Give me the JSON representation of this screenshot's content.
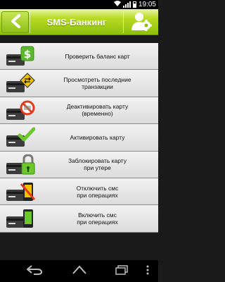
{
  "status_bar": {
    "time": "19:05"
  },
  "header": {
    "title": "SMS-Банкинг"
  },
  "menu": {
    "items": [
      {
        "label": "Проверить баланс карт",
        "icon": "card-dollar-icon"
      },
      {
        "label": "Просмотреть последние\nтранзакции",
        "icon": "card-transfer-icon"
      },
      {
        "label": "Деактивировать карту\n(временно)",
        "icon": "card-block-icon"
      },
      {
        "label": "Активировать карту",
        "icon": "card-check-icon"
      },
      {
        "label": "Заблокировать карту\nпри утере",
        "icon": "card-lock-icon"
      },
      {
        "label": "Отключить смс\nпри операциях",
        "icon": "card-phone-off-icon"
      },
      {
        "label": "Включить смс\nпри операциях",
        "icon": "card-phone-icon"
      }
    ]
  },
  "colors": {
    "header_green": "#8cbf0e",
    "accent_green": "#6cc72a",
    "warning_yellow": "#f2c200",
    "block_red": "#e03b1e"
  }
}
